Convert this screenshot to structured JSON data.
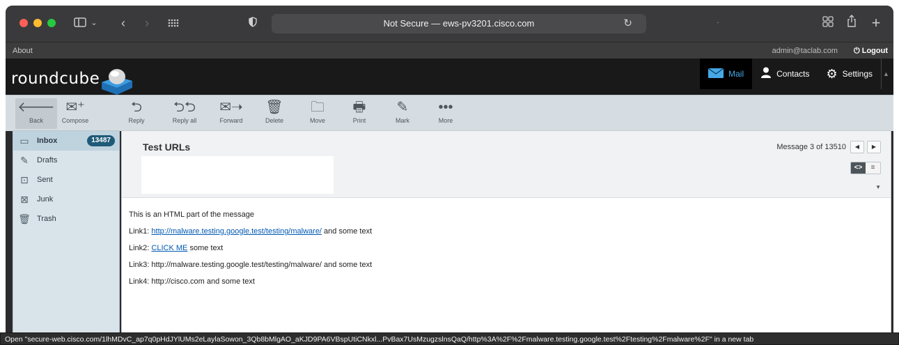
{
  "browser": {
    "url_text": "Not Secure — ews-pv3201.cisco.com",
    "icons": [
      "sidebar-icon",
      "chevron-down-icon",
      "back-icon",
      "forward-icon",
      "tab-grid-icon",
      "shield-icon",
      "reload-icon",
      "tabs-overview-icon",
      "share-icon",
      "new-tab-icon"
    ]
  },
  "topline": {
    "about": "About",
    "user": "admin@taclab.com",
    "logout": "Logout"
  },
  "logo": {
    "text": "roundcube"
  },
  "nav": {
    "mail": "Mail",
    "contacts": "Contacts",
    "settings": "Settings"
  },
  "toolbar": {
    "back": "Back",
    "compose": "Compose",
    "reply": "Reply",
    "reply_all": "Reply all",
    "forward": "Forward",
    "delete": "Delete",
    "move": "Move",
    "print": "Print",
    "mark": "Mark",
    "more": "More"
  },
  "folders": [
    {
      "label": "Inbox",
      "count": "13487",
      "icon": "inbox-icon"
    },
    {
      "label": "Drafts",
      "icon": "pencil-icon"
    },
    {
      "label": "Sent",
      "icon": "sent-icon"
    },
    {
      "label": "Junk",
      "icon": "junk-icon"
    },
    {
      "label": "Trash",
      "icon": "trash-icon"
    }
  ],
  "message": {
    "subject": "Test URLs",
    "counter": "Message 3 of 13510",
    "view_html_label": "<>",
    "view_plain_label": "≡",
    "body": {
      "line1": "This is an HTML part of the message",
      "link1_prefix": "Link1: ",
      "link1_url": "http://malware.testing.google.test/testing/malware/",
      "link1_suffix": " and some text",
      "link2_prefix": "Link2: ",
      "link2_text": "CLICK ME",
      "link2_suffix": " some text",
      "line4": "Link3: http://malware.testing.google.test/testing/malware/ and some text",
      "line5": "Link4: http://cisco.com and some text"
    }
  },
  "status_bar": "Open \"secure-web.cisco.com/1lhMDvC_ap7q0pHdJYlUMs2eLaylaSowon_3Qb8bMlgAO_aKJD9PA6VBspUtiCNkxl...PvBax7UsMzugzslnsQaQ/http%3A%2F%2Fmalware.testing.google.test%2Ftesting%2Fmalware%2F\" in a new tab",
  "colors": {
    "accent": "#47a8e6",
    "header_bg": "#191919",
    "toolbar_bg": "#d6dde2",
    "folder_bg": "#d8e3ea",
    "badge_bg": "#1f5a78",
    "link": "#0058b3"
  }
}
